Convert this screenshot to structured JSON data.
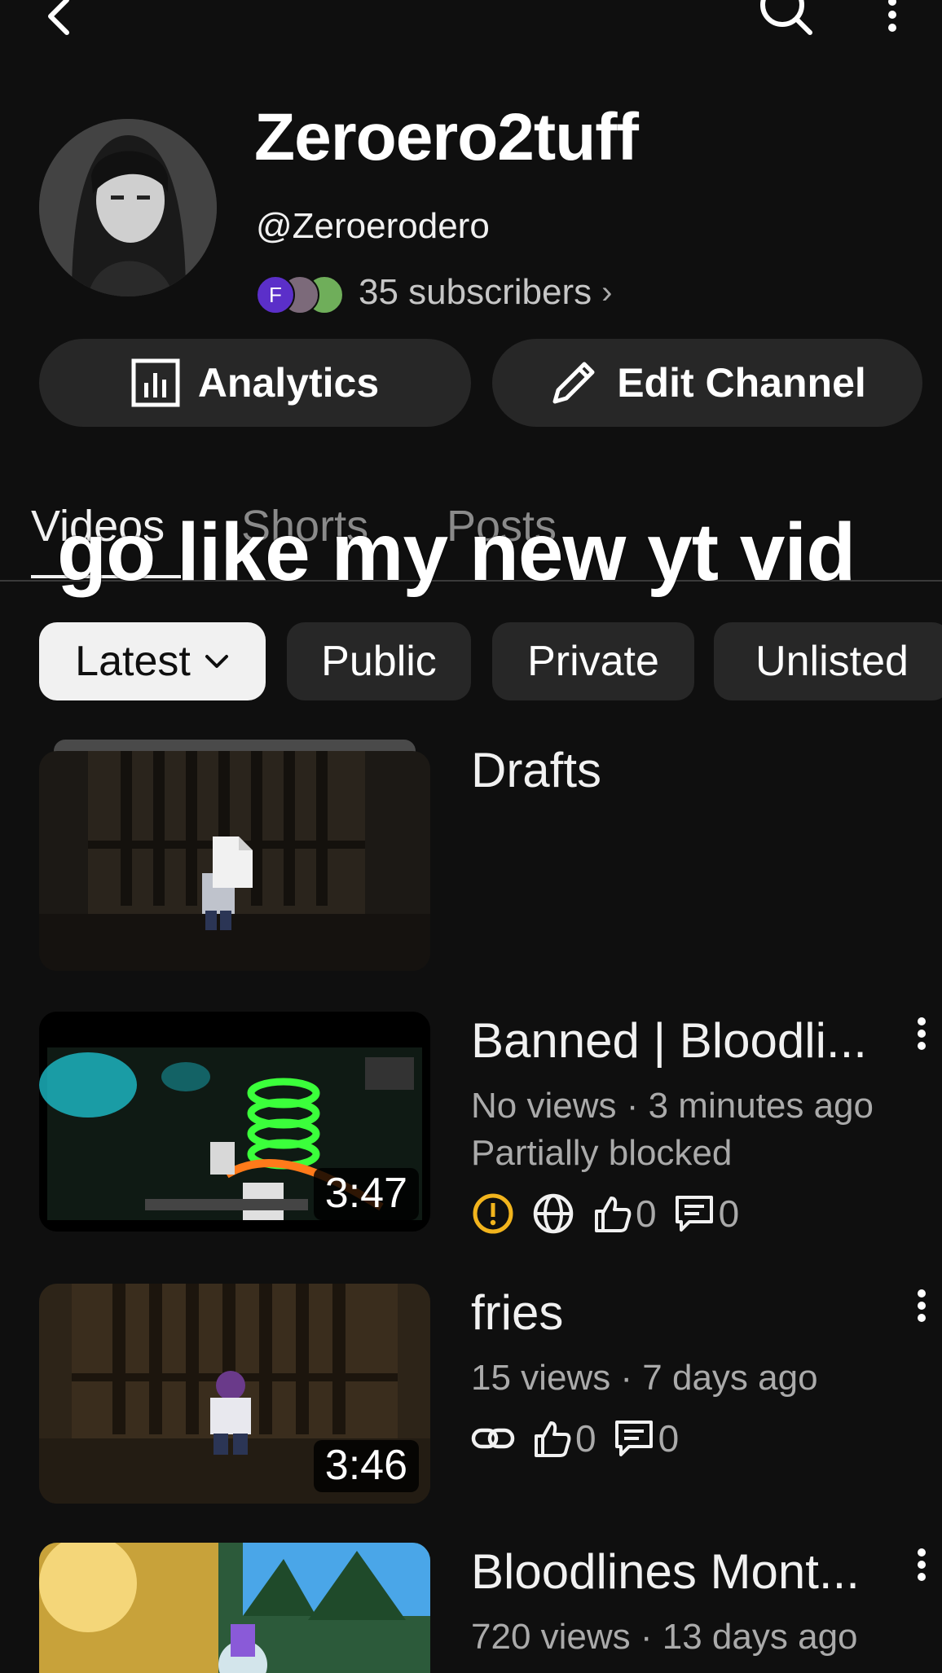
{
  "header": {
    "channel_name": "Zeroero2tuff",
    "handle": "@Zeroerodero",
    "subscriber_avatar_initial": "F",
    "subscribers": "35 subscribers",
    "chevron": "›"
  },
  "actions": {
    "analytics_label": "Analytics",
    "edit_label": "Edit Channel"
  },
  "tabs": [
    {
      "label": "Videos",
      "selected": true
    },
    {
      "label": "Shorts",
      "selected": false
    },
    {
      "label": "Posts",
      "selected": false
    }
  ],
  "overlay_caption": "go like my new yt vid",
  "filters": {
    "latest": "Latest",
    "public": "Public",
    "private": "Private",
    "unlisted": "Unlisted"
  },
  "videos": [
    {
      "title": "Drafts"
    },
    {
      "title": "Banned | Bloodli...",
      "meta": "No views · 3 minutes ago",
      "status": "Partially blocked",
      "duration": "3:47",
      "likes": "0",
      "comments": "0"
    },
    {
      "title": "fries",
      "meta": "15 views · 7 days ago",
      "duration": "3:46",
      "likes": "0",
      "comments": "0"
    },
    {
      "title": "Bloodlines Mont...",
      "meta": "720 views · 13 days ago"
    }
  ],
  "colors": {
    "background": "#0f0f0f",
    "chip": "#272727",
    "warning": "#f2b41d",
    "selected_chip": "#f1f1f1"
  }
}
